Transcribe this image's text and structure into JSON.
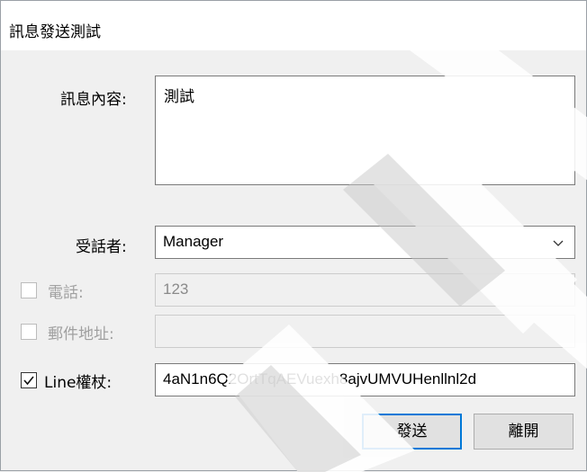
{
  "window": {
    "title": "訊息發送測試"
  },
  "message": {
    "label": "訊息內容:",
    "value": "測試"
  },
  "recipient": {
    "label": "受話者:",
    "selected": "Manager"
  },
  "phone": {
    "label": "電話:",
    "value": "123",
    "checked": false,
    "enabled": false
  },
  "email": {
    "label": "郵件地址:",
    "value": "",
    "checked": false,
    "enabled": false
  },
  "line": {
    "label": "Line權杖:",
    "value": "4aN1n6Q2OrtTqAEVuexh8ajvUMVUHenllnl2d",
    "checked": true,
    "enabled": true
  },
  "buttons": {
    "send": "發送",
    "leave": "離開"
  },
  "colors": {
    "accent": "#0078d7",
    "background": "#f0f0f0",
    "disabled_text": "#a0a0a0"
  },
  "icons": {
    "dropdown": "chevron-down-icon",
    "check": "checkmark-icon"
  }
}
